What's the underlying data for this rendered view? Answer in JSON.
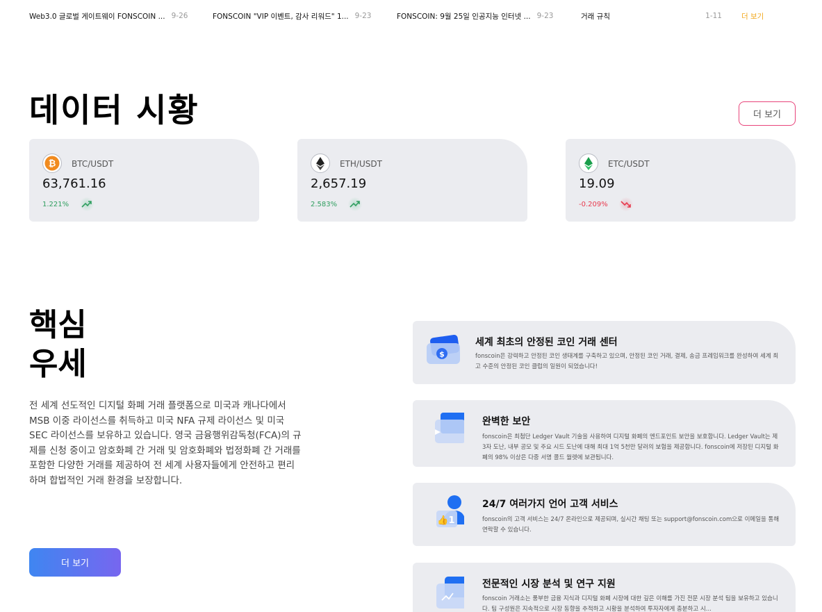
{
  "news": {
    "items": [
      {
        "title": "Web3.0 글로벌 게이트웨이 FONSCOIN ...",
        "date": "9-26"
      },
      {
        "title": "FONSCOIN \"VIP 이벤트, 감사 리워드\" 1...",
        "date": "9-23"
      },
      {
        "title": "FONSCOIN: 9월 25일 인공지능 인터넷 ...",
        "date": "9-23"
      },
      {
        "title": "거래 규칙",
        "date": "1-11"
      }
    ],
    "more_label": "더 보기"
  },
  "market": {
    "title": "데이터 시황",
    "more_label": "더 보기",
    "tickers": [
      {
        "pair": "BTC/USDT",
        "price": "63,761.16",
        "change": "1.221%",
        "direction": "up",
        "icon": "bitcoin-icon",
        "color": "#2f9e5f"
      },
      {
        "pair": "ETH/USDT",
        "price": "2,657.19",
        "change": "2.583%",
        "direction": "up",
        "icon": "ethereum-icon",
        "color": "#2f9e5f"
      },
      {
        "pair": "ETC/USDT",
        "price": "19.09",
        "change": "-0.209%",
        "direction": "down",
        "icon": "ethereum-classic-icon",
        "color": "#e8394d"
      }
    ]
  },
  "advantages": {
    "title_line1": "핵심",
    "title_line2": "우세",
    "description": "전 세계 선도적인 디지털 화폐 거래 플랫폼으로 미국과 캐나다에서 MSB 이중 라이선스를 취득하고 미국 NFA 규제 라이선스 및 미국 SEC 라이선스를 보유하고 있습니다. 영국 금융행위감독청(FCA)의 규제를 신청 중이고 암호화폐 간 거래 및 암호화폐와 법정화폐 간 거래를 포함한 다양한 거래를 제공하여 전 세계 사용자들에게 안전하고 편리하며 합법적인 거래 환경을 보장합니다.",
    "more_label": "더 보기",
    "features": [
      {
        "title": "세계 최초의 안정된 코인 거래 센터",
        "desc": "fonscoin은 강력하고 안정된 코인 생태계를 구축하고 있으며, 안정된 코인 거래, 결제, 송금 프레임워크를 완성하여 세계 최고 수준의 안정된 코인 클럽의 일원이 되었습니다!",
        "icon": "wallet-dollar-icon"
      },
      {
        "title": "완벽한 보안",
        "desc": "fonscoin은 최첨단 Ledger Vault 기술을 사용하여 디지털 화폐의 엔드포인트 보안을 보호합니다. Ledger Vault는 제3자 도난, 내부 공모 및 주요 시드 도난에 대해 최대 1억 5천만 달러의 보험을 제공합니다. fonscoin에 저장된 디지털 화폐의 98% 이상은 다중 서명 콜드 월렛에 보관됩니다.",
        "icon": "vault-icon"
      },
      {
        "title": "24/7 여러가지 언어 고객 서비스",
        "desc": "fonscoin의 고객 서비스는 24/7 온라인으로 제공되며, 실시간 채팅 또는 support@fonscoin.com으로 이메일을 통해 연락할 수 있습니다.",
        "icon": "support-user-icon"
      },
      {
        "title": "전문적인 시장 분석 및 연구 지원",
        "desc": "fonscoin 거래소는 풍부한 금융 지식과 디지털 화폐 시장에 대한 깊은 이해를 가진 전문 시장 분석 팀을 보유하고 있습니다. 팀 구성원은 지속적으로 시장 동향을 추적하고 시황을 분석하여 투자자에게 충분하고 시...",
        "icon": "chart-screen-icon"
      }
    ]
  },
  "colors": {
    "accent_pink": "#e8447a",
    "accent_orange": "#f2a81d",
    "gradient_start": "#3f86f1",
    "gradient_end": "#7766ef",
    "up": "#2f9e5f",
    "down": "#e8394d"
  }
}
